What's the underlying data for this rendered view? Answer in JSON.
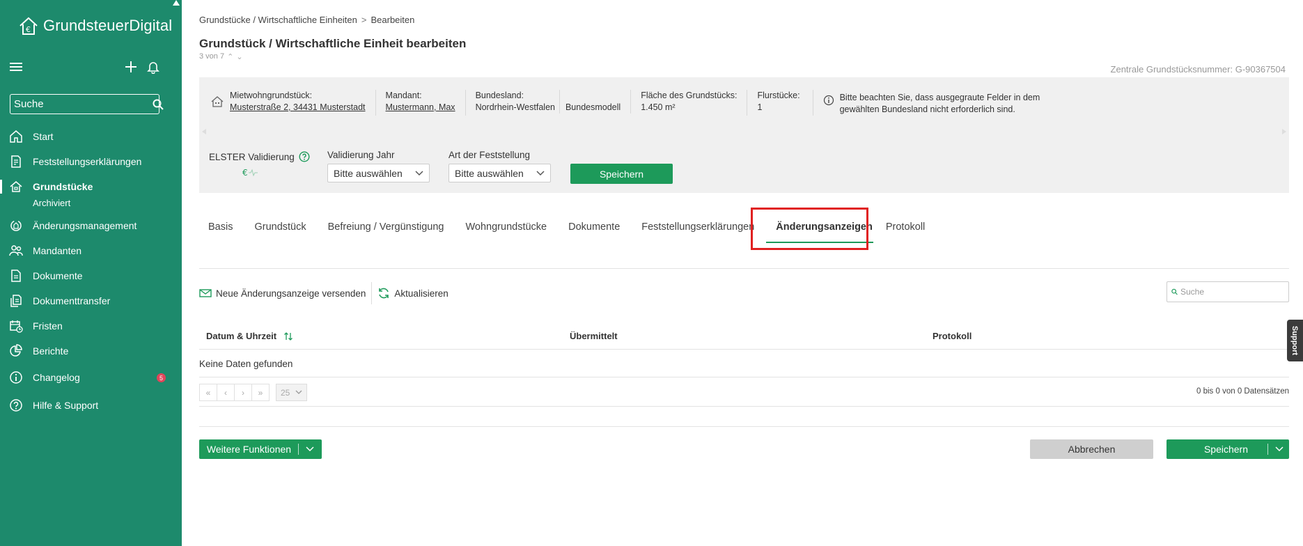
{
  "app": {
    "name": "GrundsteuerDigital"
  },
  "sidebar": {
    "search_placeholder": "Suche",
    "items": [
      {
        "label": "Start"
      },
      {
        "label": "Feststellungserklärungen"
      },
      {
        "label": "Grundstücke",
        "sub": "Archiviert"
      },
      {
        "label": "Änderungsmanagement"
      },
      {
        "label": "Mandanten"
      },
      {
        "label": "Dokumente"
      },
      {
        "label": "Dokumenttransfer"
      },
      {
        "label": "Fristen"
      },
      {
        "label": "Berichte"
      },
      {
        "label": "Changelog",
        "badge": "5"
      },
      {
        "label": "Hilfe & Support"
      }
    ]
  },
  "breadcrumb": {
    "parent": "Grundstücke / Wirtschaftliche Einheiten",
    "current": "Bearbeiten"
  },
  "page": {
    "title": "Grundstück / Wirtschaftliche Einheit bearbeiten",
    "counter": "3 von 7",
    "central_number": "Zentrale Grundstücksnummer: G-90367504"
  },
  "info": {
    "type_label": "Mietwohngrundstück:",
    "address": "Musterstraße 2, 34431 Musterstadt",
    "mandant_label": "Mandant:",
    "mandant": "Mustermann, Max",
    "bundesland_label": "Bundesland:",
    "bundesland": "Nordrhein-Westfalen",
    "modell": "Bundesmodell",
    "flaeche_label": "Fläche des Grundstücks:",
    "flaeche": "1.450 m²",
    "flurstuecke_label": "Flurstücke:",
    "flurstuecke": "1",
    "hint": "Bitte beachten Sie, dass ausgegraute Felder in dem gewählten Bundesland nicht erforderlich sind."
  },
  "validation": {
    "elster_label": "ELSTER Validierung",
    "year_label": "Validierung Jahr",
    "year_value": "Bitte auswählen",
    "type_label": "Art der Feststellung",
    "type_value": "Bitte auswählen",
    "save_label": "Speichern"
  },
  "tabs": [
    {
      "label": "Basis"
    },
    {
      "label": "Grundstück"
    },
    {
      "label": "Befreiung / Vergünstigung"
    },
    {
      "label": "Wohngrundstücke"
    },
    {
      "label": "Dokumente"
    },
    {
      "label": "Feststellungserklärungen"
    },
    {
      "label": "Änderungsanzeigen",
      "active": true
    },
    {
      "label": "Protokoll"
    }
  ],
  "toolbar": {
    "new_label": "Neue Änderungsanzeige versenden",
    "refresh_label": "Aktualisieren",
    "search_placeholder": "Suche"
  },
  "grid": {
    "columns": [
      "Datum & Uhrzeit",
      "Übermittelt",
      "Protokoll"
    ],
    "empty_text": "Keine Daten gefunden",
    "page_size": "25",
    "page_info": "0 bis 0 von 0 Datensätzen"
  },
  "footer": {
    "more_label": "Weitere Funktionen",
    "cancel_label": "Abbrechen",
    "save_label": "Speichern"
  },
  "support": {
    "label": "Support"
  },
  "colors": {
    "brand": "#1d8a6c",
    "button": "#1d9a5a",
    "highlight": "#e02020"
  }
}
